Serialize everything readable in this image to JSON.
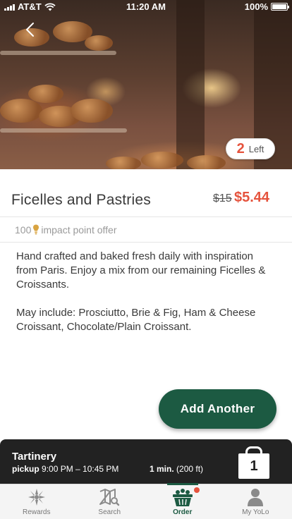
{
  "status_bar": {
    "carrier": "AT&T",
    "time": "11:20 AM",
    "battery": "100%"
  },
  "product": {
    "stock_count": "2",
    "stock_label": "Left",
    "title": "Ficelles and Pastries",
    "original_price": "$15",
    "price": "$5.44",
    "impact_points": "100",
    "impact_text": "impact point offer",
    "description_1": "Hand crafted and baked fresh daily with inspiration from Paris. Enjoy a mix from our remaining Ficelles & Croissants.",
    "description_2": "May include: Prosciutto, Brie & Fig, Ham & Cheese Croissant, Chocolate/Plain Croissant."
  },
  "actions": {
    "add_another": "Add Another"
  },
  "order_bar": {
    "store": "Tartinery",
    "pickup_label": "pickup",
    "pickup_window": "9:00 PM – 10:45 PM",
    "travel_time": "1 min.",
    "distance": "(200 ft)",
    "cart_count": "1"
  },
  "tabs": [
    {
      "label": "Rewards",
      "icon": "rewards-icon"
    },
    {
      "label": "Search",
      "icon": "map-search-icon"
    },
    {
      "label": "Order",
      "icon": "basket-icon"
    },
    {
      "label": "My YoLo",
      "icon": "profile-icon"
    }
  ],
  "colors": {
    "accent_green": "#1c5a42",
    "price_red": "#e5533d",
    "bar_dark": "#222222"
  }
}
